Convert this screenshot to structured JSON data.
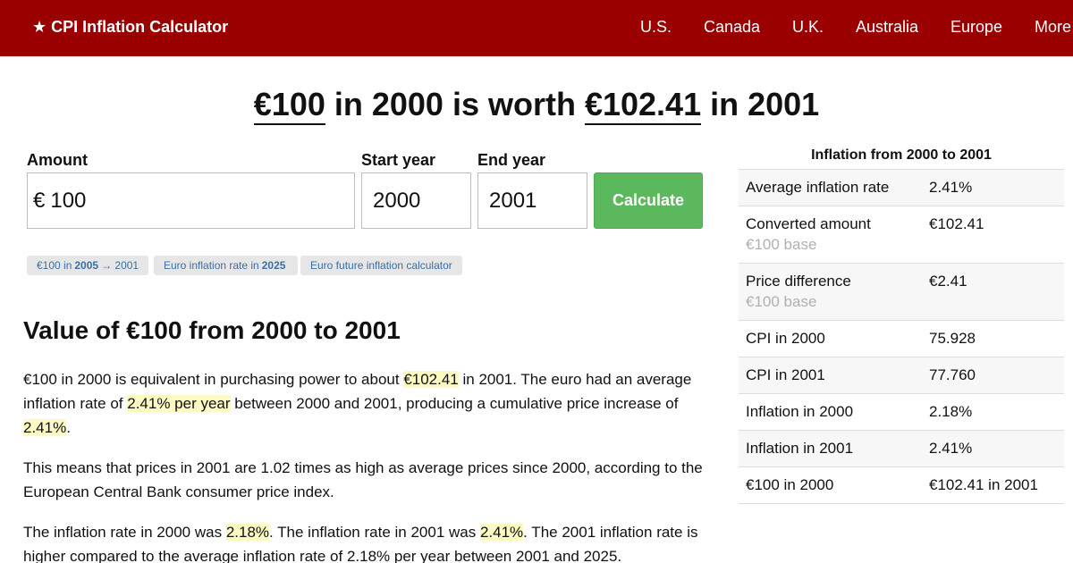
{
  "header": {
    "brand": "★ CPI Inflation Calculator",
    "nav": [
      "U.S.",
      "Canada",
      "U.K.",
      "Australia",
      "Europe",
      "More"
    ]
  },
  "headline": {
    "amount": "€100",
    "mid1": " in 2000 is worth ",
    "result": "€102.41",
    "mid2": " in 2001"
  },
  "form": {
    "amount_label": "Amount",
    "currency_symbol": "€",
    "amount_value": "100",
    "start_label": "Start year",
    "start_value": "2000",
    "end_label": "End year",
    "end_value": "2001",
    "calculate_label": "Calculate"
  },
  "chips": [
    {
      "pre": "€100 in",
      "bold": "2005",
      "post": "→ 2001"
    },
    {
      "pre": "Euro inflation rate in",
      "bold": "2025",
      "post": ""
    },
    {
      "pre": "Euro future inflation calculator",
      "bold": "",
      "post": ""
    }
  ],
  "article": {
    "heading": "Value of €100 from 2000 to 2001",
    "p1": {
      "a": "€100 in 2000 is equivalent in purchasing power to about ",
      "h1": "€102.41",
      "b": " in 2001. The euro had an average inflation rate of ",
      "h2": "2.41% per year",
      "c": " between 2000 and 2001, producing a cumulative price increase of ",
      "h3": "2.41%",
      "d": "."
    },
    "p2": "This means that prices in 2001 are 1.02 times as high as average prices since 2000, according to the European Central Bank consumer price index.",
    "p3": {
      "a": "The inflation rate in 2000 was ",
      "h1": "2.18%",
      "b": ". The inflation rate in 2001 was ",
      "h2": "2.41%",
      "c": ". The 2001 inflation rate is higher compared to the average inflation rate of 2.18% per year between 2001 and 2025."
    }
  },
  "side": {
    "title": "Inflation from 2000 to 2001",
    "rows": [
      {
        "k": "Average inflation rate",
        "v": "2.41%",
        "sub": ""
      },
      {
        "k": "Converted amount",
        "v": "€102.41",
        "sub": "€100 base"
      },
      {
        "k": "Price difference",
        "v": "€2.41",
        "sub": "€100 base"
      },
      {
        "k": "CPI in 2000",
        "v": "75.928",
        "sub": ""
      },
      {
        "k": "CPI in 2001",
        "v": "77.760",
        "sub": ""
      },
      {
        "k": "Inflation in 2000",
        "v": "2.18%",
        "sub": ""
      },
      {
        "k": "Inflation in 2001",
        "v": "2.41%",
        "sub": ""
      },
      {
        "k": "€100 in 2000",
        "v": "€102.41 in 2001",
        "sub": ""
      }
    ]
  }
}
